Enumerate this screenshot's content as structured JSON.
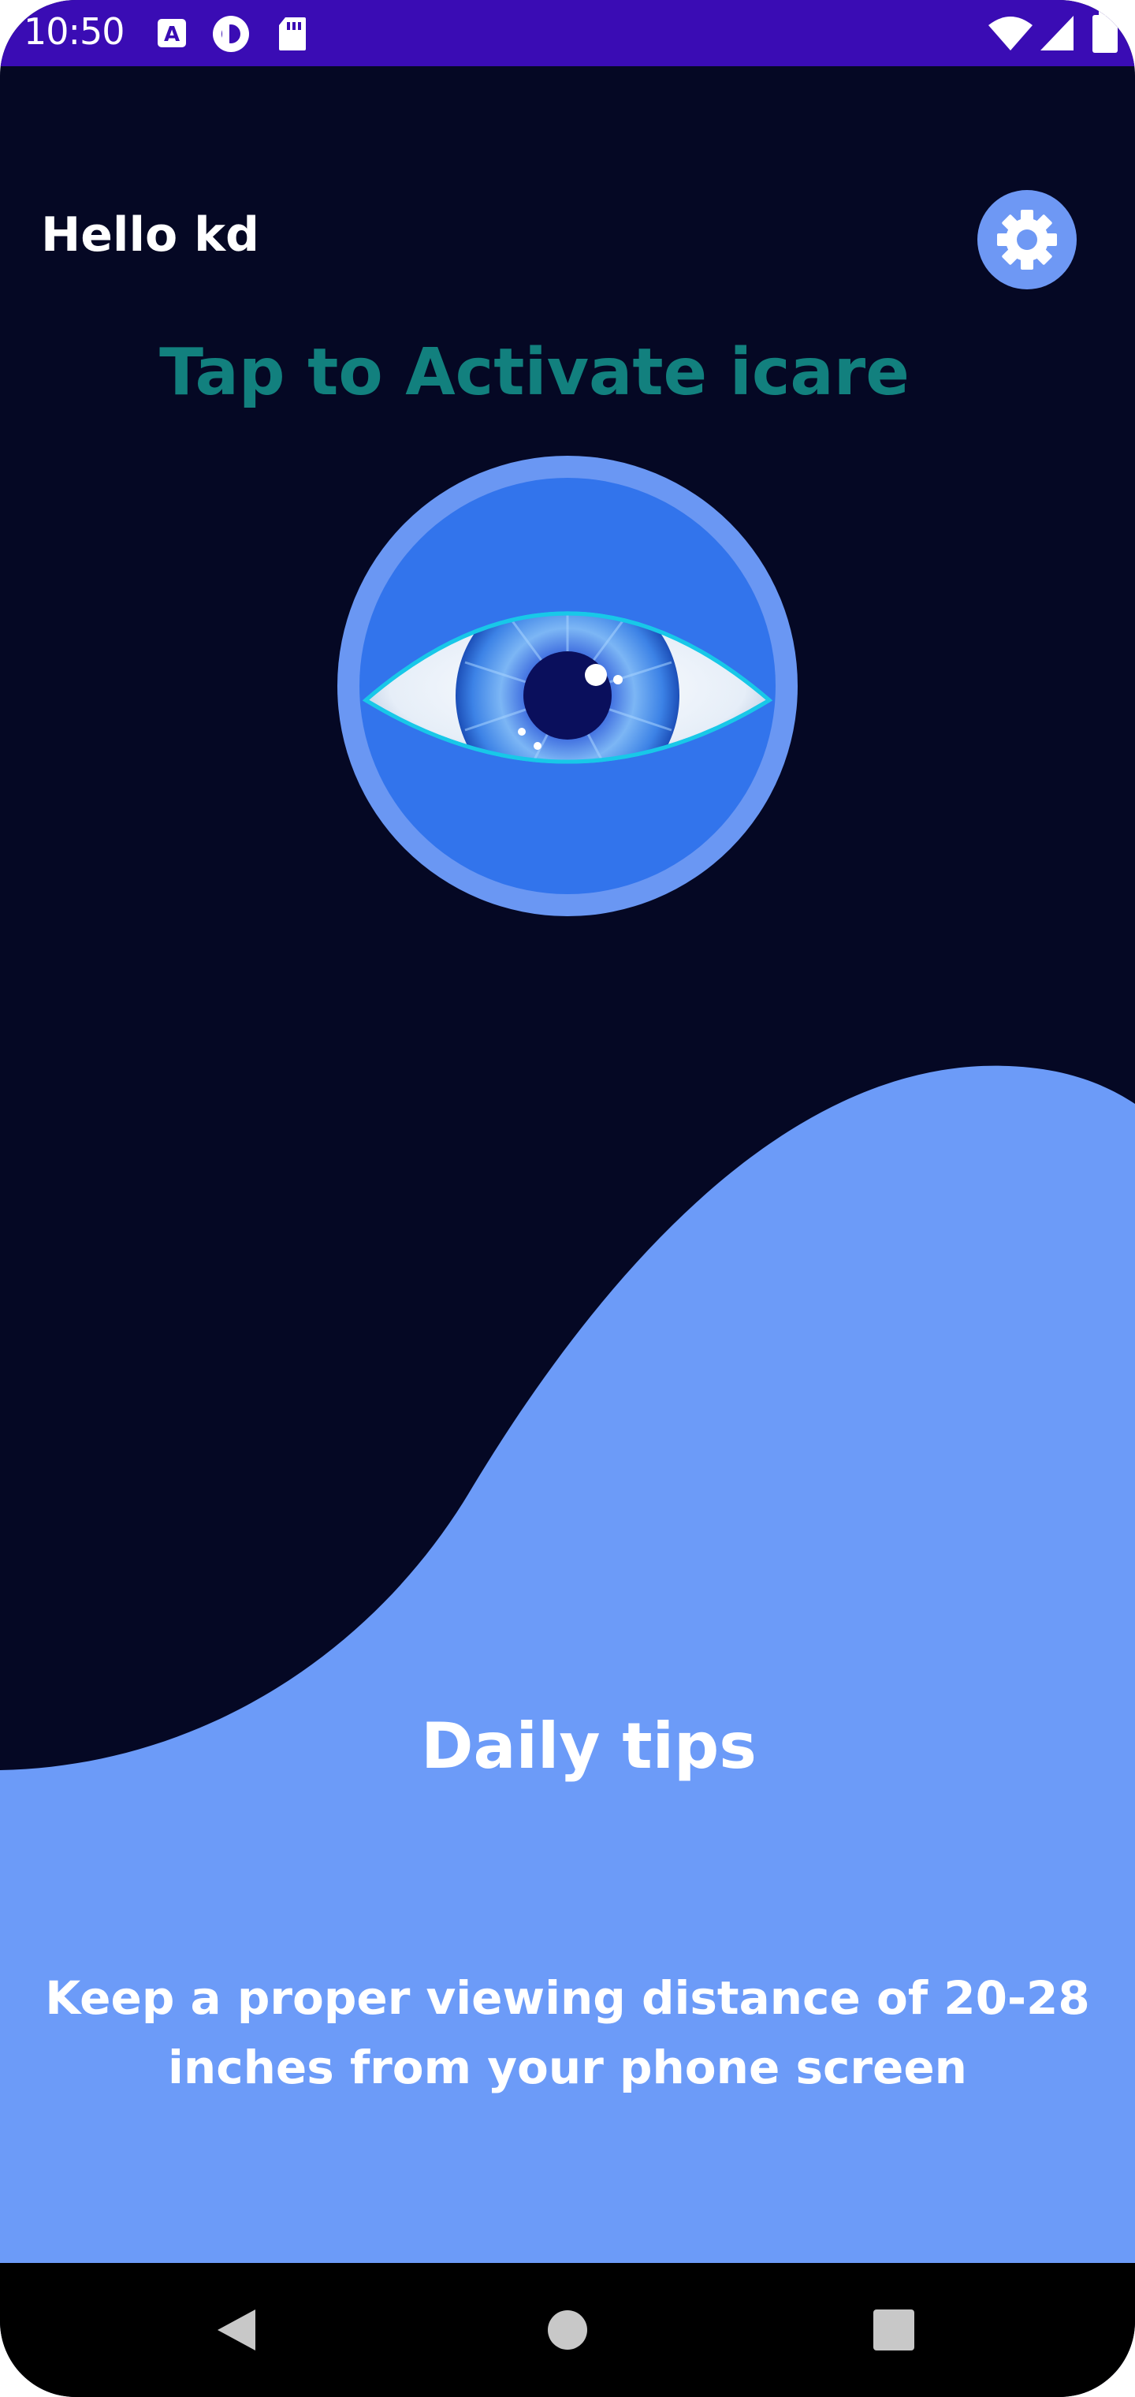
{
  "status_bar": {
    "time": "10:50",
    "icons": [
      "font-icon",
      "pocket-casts-icon",
      "sd-card-icon",
      "wifi-icon",
      "cell-signal-icon",
      "battery-icon"
    ]
  },
  "header": {
    "greeting": "Hello kd",
    "settings_icon": "gear-icon"
  },
  "main": {
    "activate_title": "Tap to Activate icare",
    "eye_icon": "eye-icon"
  },
  "tips": {
    "title": "Daily tips",
    "text": "Keep a proper viewing distance of 20-28 inches from your phone screen"
  },
  "nav": {
    "buttons": [
      "back-icon",
      "home-icon",
      "recents-icon"
    ]
  },
  "colors": {
    "background": "#050824",
    "status_bar": "#3a0cb4",
    "accent": "#6e98f4",
    "title": "#12807e",
    "wave": "#6c9bf8"
  }
}
